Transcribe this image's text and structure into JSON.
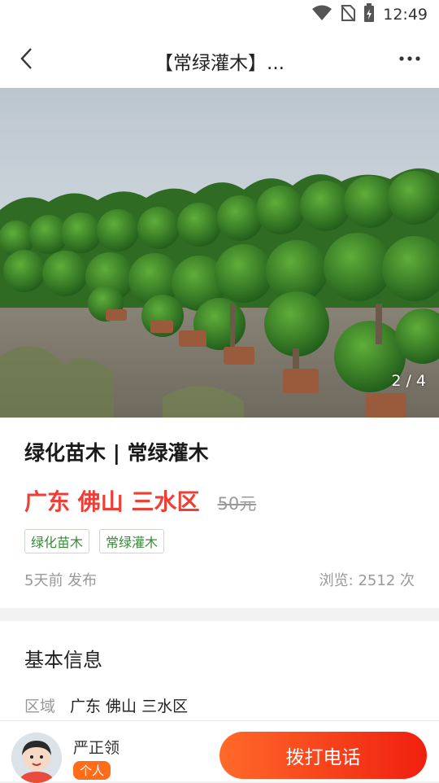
{
  "status_bar": {
    "time": "12:49"
  },
  "nav": {
    "title": "【常绿灌木】..."
  },
  "hero": {
    "pager": "2 / 4"
  },
  "listing": {
    "title": "绿化苗木 | 常绿灌木",
    "location": "广东 佛山 三水区",
    "original_price": "50元",
    "tags": [
      "绿化苗木",
      "常绿灌木"
    ],
    "posted": "5天前 发布",
    "views": "浏览: 2512 次"
  },
  "basic_info": {
    "title": "基本信息",
    "region_label": "区域",
    "region_value": "广东 佛山 三水区"
  },
  "seller": {
    "name": "严正领",
    "badge": "个人",
    "call_label": "拨打电话"
  },
  "colors": {
    "accent": "#ef3e36",
    "call_gradient_start": "#ff6a2a",
    "call_gradient_end": "#ef1f0f",
    "tag_text": "#3a8a3a"
  }
}
